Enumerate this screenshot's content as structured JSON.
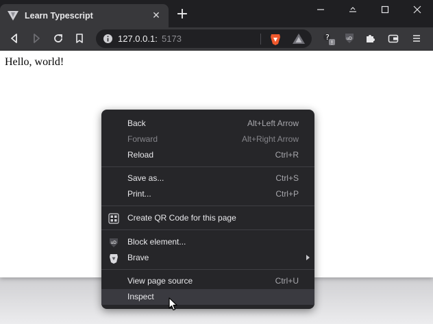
{
  "tab": {
    "title": "Learn Typescript",
    "close_glyph": "✕",
    "favicon": "vite-logo-icon"
  },
  "newtab_glyph": "+",
  "window_controls": {
    "minimize": "minimize-icon",
    "maximize": "maximize-icon",
    "close": "close-icon"
  },
  "toolbar": {
    "url_host": "127.0.0.1:",
    "url_port": "5173",
    "buttons": [
      "back-icon",
      "forward-icon",
      "reload-icon",
      "bookmark-icon",
      "brave-shields-icon",
      "brave-rewards-icon",
      "tor-ext-icon",
      "ublock-icon",
      "extensions-icon",
      "wallet-icon",
      "menu-icon"
    ]
  },
  "page": {
    "text": "Hello, world!"
  },
  "context_menu": {
    "items": [
      {
        "label": "Back",
        "shortcut": "Alt+Left Arrow"
      },
      {
        "label": "Forward",
        "shortcut": "Alt+Right Arrow",
        "disabled": true
      },
      {
        "label": "Reload",
        "shortcut": "Ctrl+R"
      },
      {
        "label": "Save as...",
        "shortcut": "Ctrl+S"
      },
      {
        "label": "Print...",
        "shortcut": "Ctrl+P"
      },
      {
        "label": "Create QR Code for this page",
        "icon": "qr-code-icon"
      },
      {
        "label": "Block element...",
        "icon": "ublock-icon"
      },
      {
        "label": "Brave",
        "icon": "brave-lion-icon",
        "submenu": true
      },
      {
        "label": "View page source",
        "shortcut": "Ctrl+U"
      },
      {
        "label": "Inspect",
        "hovered": true
      }
    ]
  },
  "colors": {
    "titlebar": "#1f1f22",
    "toolbar": "#38383b",
    "menu_bg": "#262629",
    "menu_hover": "#3a3a40"
  }
}
